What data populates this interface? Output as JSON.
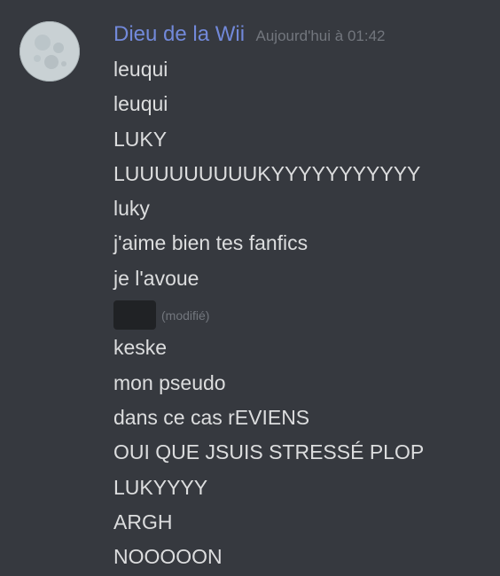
{
  "message": {
    "author": "Dieu de la Wii",
    "timestamp": "Aujourd'hui à 01:42",
    "avatar_icon": "moon-avatar",
    "author_color": "#7289da",
    "lines": [
      "leuqui",
      "leuqui",
      "LUKY",
      "LUUUUUUUUUKYYYYYYYYYYY",
      "luky",
      "j'aime bien tes fanfics",
      "je l'avoue"
    ],
    "spoiler": {
      "edited_label": "(modifié)"
    },
    "lines_after": [
      "keske",
      "mon pseudo",
      "dans ce cas rEVIENS",
      "OUI QUE JSUIS STRESSÉ PLOP",
      "LUKYYYY",
      "ARGH",
      "NOOOOON"
    ]
  }
}
